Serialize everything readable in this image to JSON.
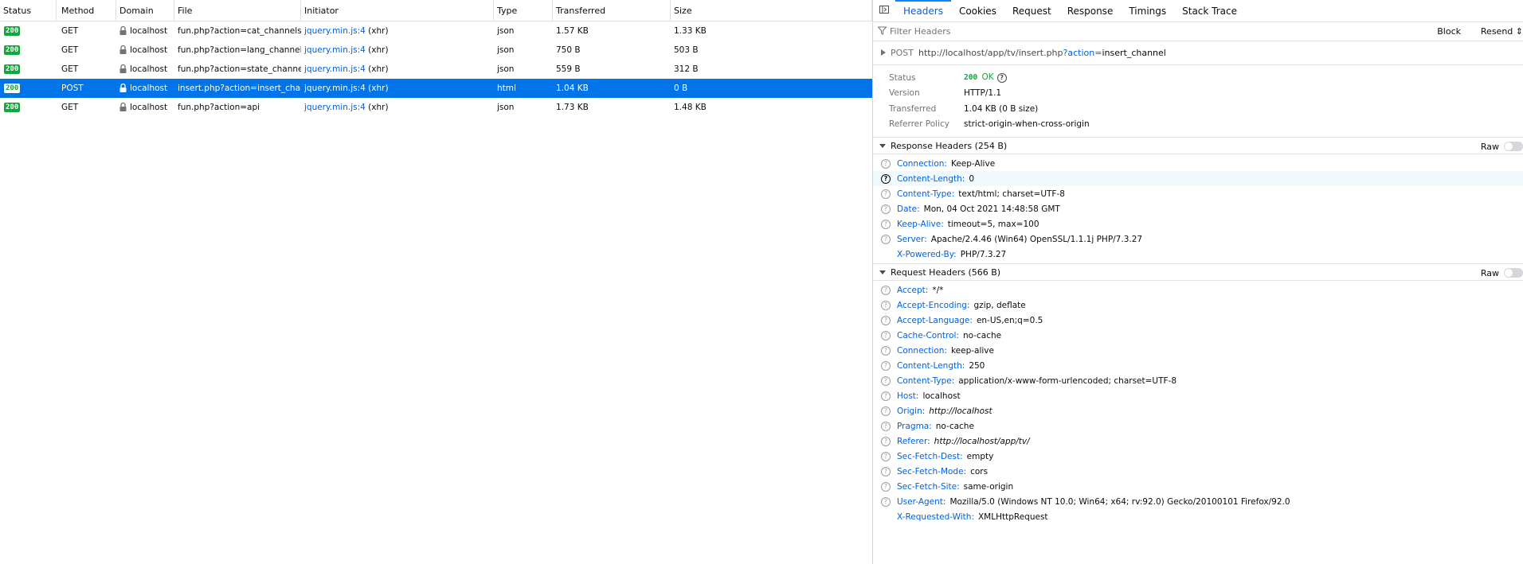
{
  "columns": [
    "Status",
    "Method",
    "Domain",
    "File",
    "Initiator",
    "Type",
    "Transferred",
    "Size"
  ],
  "requests": [
    {
      "status": "200",
      "method": "GET",
      "domain": "localhost",
      "file": "fun.php?action=cat_channels",
      "initiator": "jquery.min.js:4",
      "initiator_type": "(xhr)",
      "type": "json",
      "transferred": "1.57 KB",
      "size": "1.33 KB"
    },
    {
      "status": "200",
      "method": "GET",
      "domain": "localhost",
      "file": "fun.php?action=lang_channels",
      "initiator": "jquery.min.js:4",
      "initiator_type": "(xhr)",
      "type": "json",
      "transferred": "750 B",
      "size": "503 B"
    },
    {
      "status": "200",
      "method": "GET",
      "domain": "localhost",
      "file": "fun.php?action=state_channels",
      "initiator": "jquery.min.js:4",
      "initiator_type": "(xhr)",
      "type": "json",
      "transferred": "559 B",
      "size": "312 B"
    },
    {
      "status": "200",
      "method": "POST",
      "domain": "localhost",
      "file": "insert.php?action=insert_channel",
      "initiator": "jquery.min.js:4",
      "initiator_type": "(xhr)",
      "type": "html",
      "transferred": "1.04 KB",
      "size": "0 B"
    },
    {
      "status": "200",
      "method": "GET",
      "domain": "localhost",
      "file": "fun.php?action=api",
      "initiator": "jquery.min.js:4",
      "initiator_type": "(xhr)",
      "type": "json",
      "transferred": "1.73 KB",
      "size": "1.48 KB"
    }
  ],
  "selected_index": 3,
  "details": {
    "tabs": [
      "Headers",
      "Cookies",
      "Request",
      "Response",
      "Timings",
      "Stack Trace"
    ],
    "active_tab": "Headers",
    "filter_placeholder": "Filter Headers",
    "block_label": "Block",
    "resend_label": "Resend",
    "summary": {
      "method": "POST",
      "url_base": "http://localhost/app/tv/insert.php",
      "url_q": "?action=",
      "url_v": "insert_channel"
    },
    "overview": {
      "status_label": "Status",
      "status_code": "200",
      "status_text": "OK",
      "version_label": "Version",
      "version": "HTTP/1.1",
      "transferred_label": "Transferred",
      "transferred": "1.04 KB (0 B size)",
      "referrer_label": "Referrer Policy",
      "referrer": "strict-origin-when-cross-origin"
    },
    "response_headers_title": "Response Headers (254 B)",
    "request_headers_title": "Request Headers (566 B)",
    "raw_label": "Raw",
    "response_headers": [
      {
        "name": "Connection:",
        "value": "Keep-Alive"
      },
      {
        "name": "Content-Length:",
        "value": "0"
      },
      {
        "name": "Content-Type:",
        "value": "text/html; charset=UTF-8"
      },
      {
        "name": "Date:",
        "value": "Mon, 04 Oct 2021 14:48:58 GMT"
      },
      {
        "name": "Keep-Alive:",
        "value": "timeout=5, max=100"
      },
      {
        "name": "Server:",
        "value": "Apache/2.4.46 (Win64) OpenSSL/1.1.1j PHP/7.3.27"
      },
      {
        "name": "X-Powered-By:",
        "value": "PHP/7.3.27"
      }
    ],
    "request_headers": [
      {
        "name": "Accept:",
        "value": "*/*"
      },
      {
        "name": "Accept-Encoding:",
        "value": "gzip, deflate"
      },
      {
        "name": "Accept-Language:",
        "value": "en-US,en;q=0.5"
      },
      {
        "name": "Cache-Control:",
        "value": "no-cache"
      },
      {
        "name": "Connection:",
        "value": "keep-alive"
      },
      {
        "name": "Content-Length:",
        "value": "250"
      },
      {
        "name": "Content-Type:",
        "value": "application/x-www-form-urlencoded; charset=UTF-8"
      },
      {
        "name": "Host:",
        "value": "localhost"
      },
      {
        "name": "Origin:",
        "value": "http://localhost"
      },
      {
        "name": "Pragma:",
        "value": "no-cache"
      },
      {
        "name": "Referer:",
        "value": "http://localhost/app/tv/"
      },
      {
        "name": "Sec-Fetch-Dest:",
        "value": "empty"
      },
      {
        "name": "Sec-Fetch-Mode:",
        "value": "cors"
      },
      {
        "name": "Sec-Fetch-Site:",
        "value": "same-origin"
      },
      {
        "name": "User-Agent:",
        "value": "Mozilla/5.0 (Windows NT 10.0; Win64; x64; rv:92.0) Gecko/20100101 Firefox/92.0"
      },
      {
        "name": "X-Requested-With:",
        "value": "XMLHttpRequest"
      }
    ]
  }
}
